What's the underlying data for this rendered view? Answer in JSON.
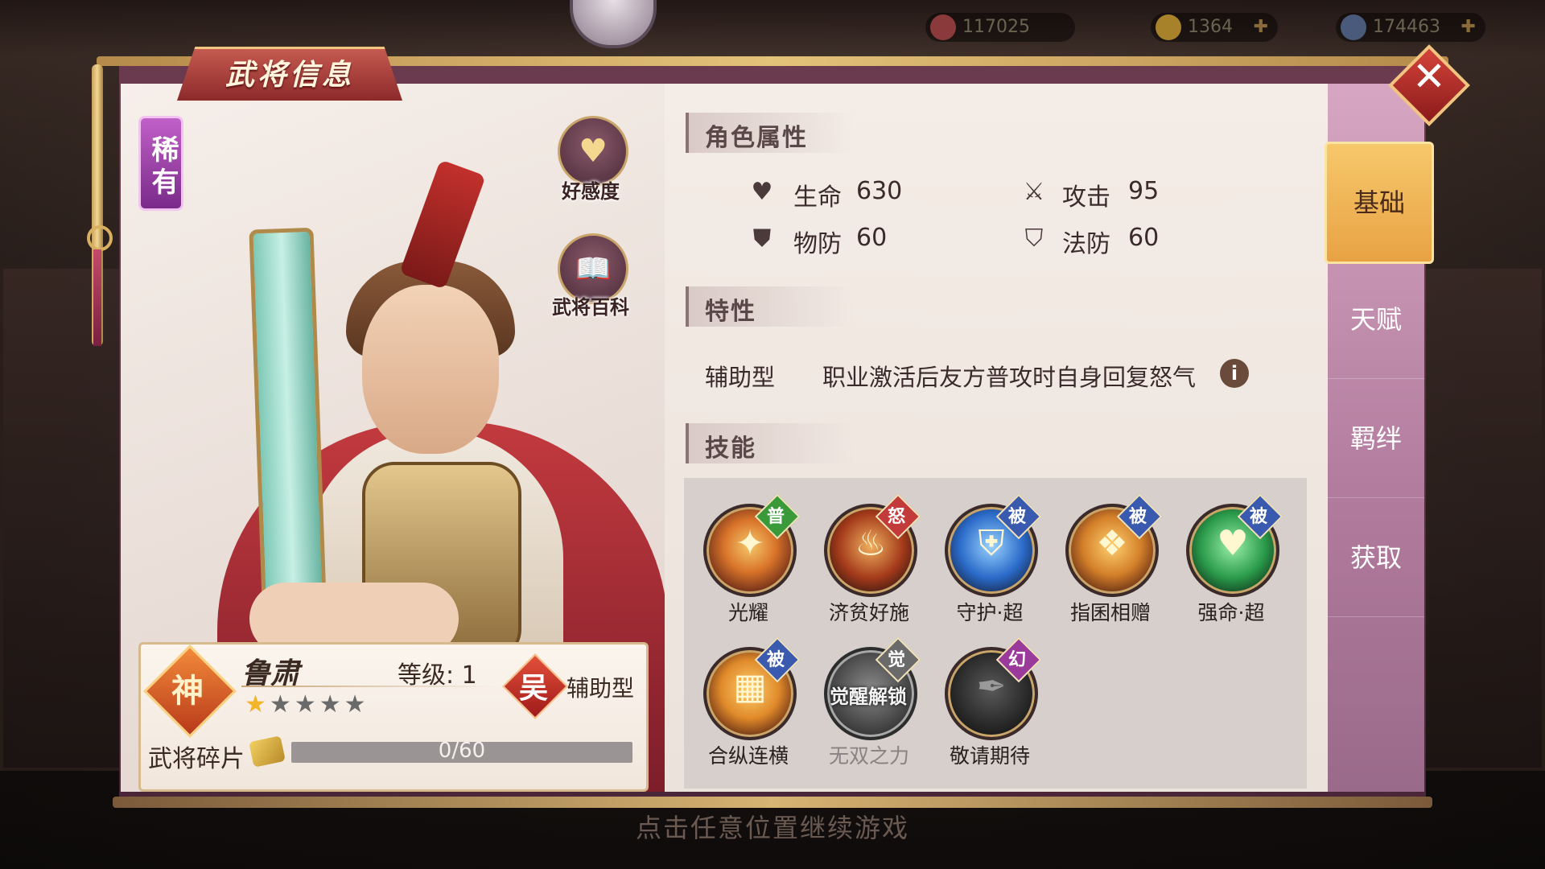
{
  "hud": {
    "title": "",
    "resources": [
      {
        "value": "117025",
        "icon": "stamina-icon",
        "color": "#c94a4a"
      },
      {
        "value": "1364",
        "icon": "gold-ingot-icon",
        "color": "#d9a83a"
      },
      {
        "value": "174463",
        "icon": "silver-coin-icon",
        "color": "#7a8aa8"
      }
    ]
  },
  "panel": {
    "title": "武将信息",
    "close_icon": "close-icon"
  },
  "hero": {
    "rarity": "稀有",
    "favor_label": "好感度",
    "encyclopedia_label": "武将百科",
    "faction_badge": "神",
    "name": "鲁肃",
    "level_label": "等级: 1",
    "stars_total": 5,
    "stars_filled": 1,
    "kingdom_badge": "吴",
    "role": "辅助型",
    "shards_label": "武将碎片",
    "shards_text": "0/60",
    "shards_progress": 0
  },
  "attributes": {
    "section_title": "角色属性",
    "items": [
      {
        "label": "生命",
        "value": "630",
        "icon": "heart-icon"
      },
      {
        "label": "攻击",
        "value": "95",
        "icon": "sword-icon"
      },
      {
        "label": "物防",
        "value": "60",
        "icon": "shield-icon"
      },
      {
        "label": "法防",
        "value": "60",
        "icon": "lightning-shield-icon"
      }
    ]
  },
  "traits": {
    "section_title": "特性",
    "type": "辅助型",
    "description": "职业激活后友方普攻时自身回复怒气"
  },
  "skills": {
    "section_title": "技能",
    "items": [
      {
        "name": "光耀",
        "tag": "普",
        "tag_color": "#3a9a3a",
        "locked": false
      },
      {
        "name": "济贫好施",
        "tag": "怒",
        "tag_color": "#c23a3a",
        "locked": false
      },
      {
        "name": "守护·超",
        "tag": "被",
        "tag_color": "#3a5ab0",
        "locked": false
      },
      {
        "name": "指囷相赠",
        "tag": "被",
        "tag_color": "#3a5ab0",
        "locked": false
      },
      {
        "name": "强命·超",
        "tag": "被",
        "tag_color": "#3a5ab0",
        "locked": false
      },
      {
        "name": "合纵连横",
        "tag": "被",
        "tag_color": "#3a5ab0",
        "locked": false
      },
      {
        "name": "无双之力",
        "tag": "觉",
        "tag_color": "#6a6a6a",
        "locked": true,
        "lock_text": "觉醒解锁"
      },
      {
        "name": "敬请期待",
        "tag": "幻",
        "tag_color": "#9a3a9a",
        "locked": false
      }
    ]
  },
  "tabs": [
    {
      "label": "基础",
      "active": true
    },
    {
      "label": "天赋",
      "active": false
    },
    {
      "label": "羁绊",
      "active": false
    },
    {
      "label": "获取",
      "active": false
    }
  ],
  "footer_hint": "点击任意位置继续游戏"
}
